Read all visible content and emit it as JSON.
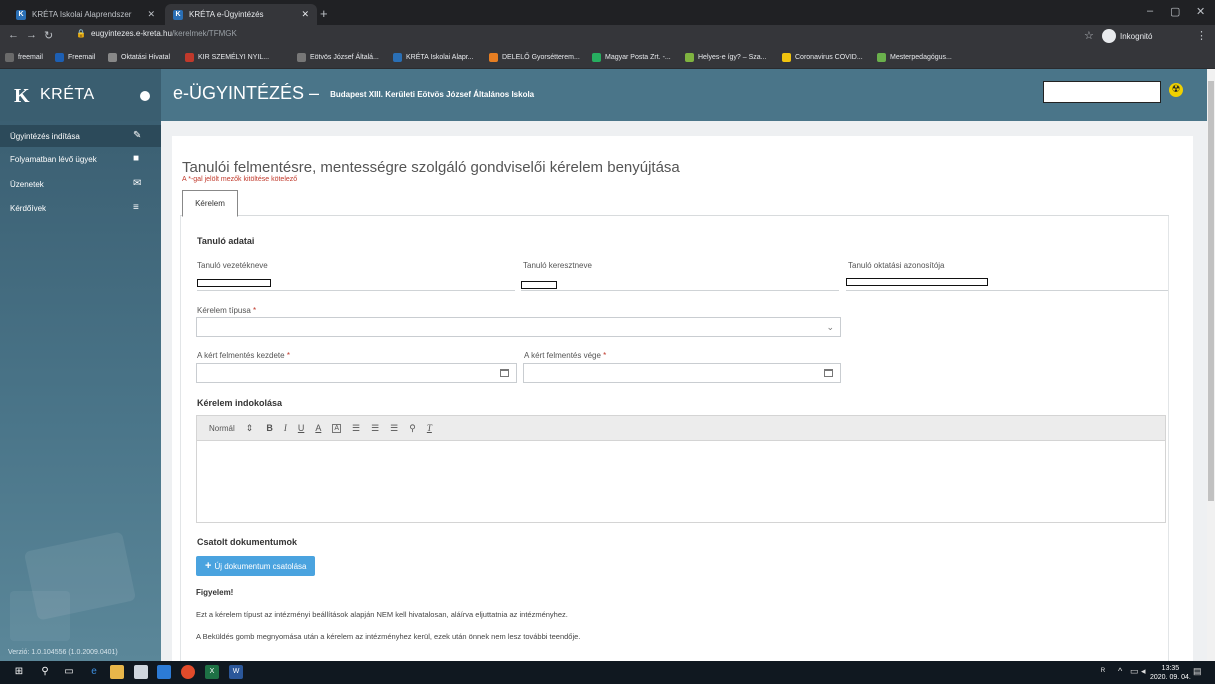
{
  "browser": {
    "tabs": [
      {
        "label": "KRÉTA Iskolai Alaprendszer",
        "active": false
      },
      {
        "label": "KRÉTA e-Ügyintézés",
        "active": true
      }
    ],
    "url_host": "eugyintezes.e-kreta.hu",
    "url_path": "/kerelmek/TFMGK",
    "profile": "Inkognitó",
    "bookmarks": [
      {
        "label": "freemail",
        "color": "#6a6a6a"
      },
      {
        "label": "Freemail",
        "color": "#1d5fb3"
      },
      {
        "label": "Oktatási Hivatal",
        "color": "#888888"
      },
      {
        "label": "KIR SZEMÉLYI NYIL...",
        "color": "#c0392b"
      },
      {
        "label": "Eötvös József Általá...",
        "color": "#777777"
      },
      {
        "label": "KRÉTA Iskolai Alapr...",
        "color": "#2a6fb5"
      },
      {
        "label": "DELELŐ Gyorsétterem...",
        "color": "#e67e22"
      },
      {
        "label": "Magyar Posta Zrt. -...",
        "color": "#27ae60"
      },
      {
        "label": "Helyes-e így? – Sza...",
        "color": "#7fb340"
      },
      {
        "label": "Coronavirus COVID...",
        "color": "#f1c40f"
      },
      {
        "label": "Mesterpedagógus...",
        "color": "#6ab04c"
      }
    ]
  },
  "header": {
    "brand": "KRÉTA",
    "title": "e-ÜGYINTÉZÉS",
    "separator": "–",
    "school": "Budapest XIII. Kerületi Eötvös József Általános Iskola"
  },
  "sidebar": {
    "items": [
      {
        "label": "Ügyintézés indítása",
        "icon": "edit-icon",
        "glyph": "✎"
      },
      {
        "label": "Folyamatban lévő ügyek",
        "icon": "folder-icon",
        "glyph": "■"
      },
      {
        "label": "Üzenetek",
        "icon": "envelope-icon",
        "glyph": "✉"
      },
      {
        "label": "Kérdőívek",
        "icon": "list-icon",
        "glyph": "≡"
      }
    ],
    "version": "Verzió: 1.0.104556 (1.0.2009.0401)"
  },
  "main": {
    "title": "Tanulói felmentésre, mentességre szolgáló gondviselői kérelem benyújtása",
    "required_note": "A *-gal jelölt mezők kitöltése kötelező",
    "tab": "Kérelem",
    "student_section": "Tanuló adatai",
    "student_fields": {
      "last_name": "Tanuló vezetékneve",
      "first_name": "Tanuló keresztneve",
      "edu_id": "Tanuló oktatási azonosítója"
    },
    "request_type_label": "Kérelem típusa",
    "start_label": "A kért felmentés kezdete",
    "end_label": "A kért felmentés vége",
    "required_mark": "*",
    "justification_section": "Kérelem indokolása",
    "editor": {
      "format": "Normál",
      "buttons": [
        "B",
        "I",
        "U",
        "A",
        "A",
        "☰",
        "☰",
        "☰",
        "⚲",
        "T"
      ]
    },
    "attachments_section": "Csatolt dokumentumok",
    "upload_button": "Új dokumentum csatolása",
    "warning_title": "Figyelem!",
    "warning_lines": [
      "Ezt a kérelem típust az intézményi beállítások alapján NEM kell hivatalosan, aláírva eljuttatnia az intézményhez.",
      "A Beküldés gomb megnyomása után a kérelem az intézményhez kerül, ezek után önnek nem lesz további teendője."
    ]
  },
  "taskbar": {
    "time": "13:35",
    "date": "2020. 09. 04."
  }
}
